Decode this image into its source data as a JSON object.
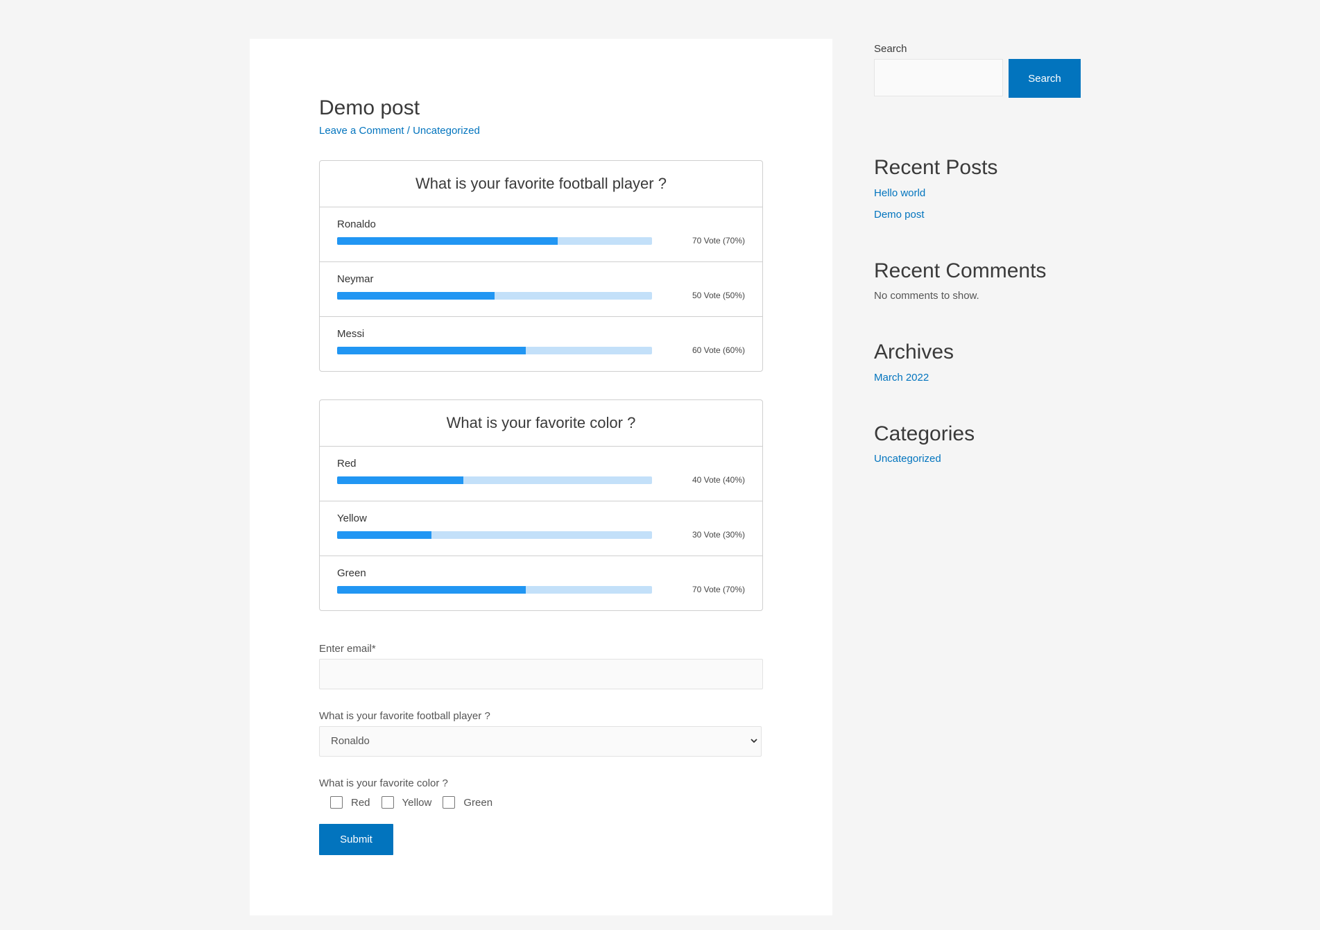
{
  "post": {
    "title": "Demo post",
    "meta_comment": "Leave a Comment",
    "meta_sep": " / ",
    "meta_category": "Uncategorized"
  },
  "polls": [
    {
      "question": "What is your favorite football player ?",
      "options": [
        {
          "label": "Ronaldo",
          "percent": 70,
          "count": "70 Vote (70%)"
        },
        {
          "label": "Neymar",
          "percent": 50,
          "count": "50 Vote (50%)"
        },
        {
          "label": "Messi",
          "percent": 60,
          "count": "60 Vote (60%)"
        }
      ]
    },
    {
      "question": "What is your favorite color ?",
      "options": [
        {
          "label": "Red",
          "percent": 40,
          "count": "40 Vote (40%)"
        },
        {
          "label": "Yellow",
          "percent": 30,
          "count": "30 Vote (30%)"
        },
        {
          "label": "Green",
          "percent": 60,
          "count": "70 Vote (70%)"
        }
      ]
    }
  ],
  "form": {
    "email_label": "Enter email*",
    "player_label": "What is your favorite football player ?",
    "player_selected": "Ronaldo",
    "color_label": "What is your favorite color ?",
    "color_options": [
      "Red",
      "Yellow",
      "Green"
    ],
    "submit_label": "Submit"
  },
  "sidebar": {
    "search_label": "Search",
    "search_button": "Search",
    "recent_posts_title": "Recent Posts",
    "recent_posts": [
      "Hello world",
      "Demo post"
    ],
    "recent_comments_title": "Recent Comments",
    "recent_comments_empty": "No comments to show.",
    "archives_title": "Archives",
    "archives": [
      "March 2022"
    ],
    "categories_title": "Categories",
    "categories": [
      "Uncategorized"
    ]
  },
  "colors": {
    "accent": "#0274be",
    "bar_fill": "#2196f3",
    "bar_track": "#c3e0f9"
  }
}
